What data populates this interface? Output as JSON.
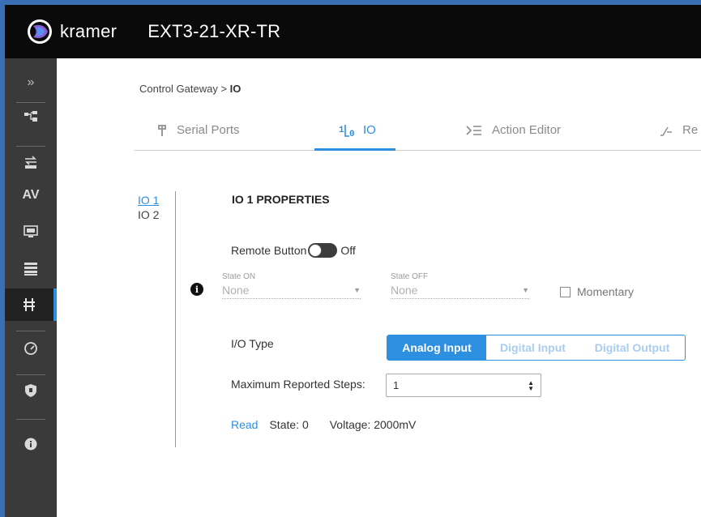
{
  "app": {
    "brand": "kramer",
    "device_name": "EXT3-21-XR-TR"
  },
  "sidebar": {
    "items": [
      {
        "name": "expand",
        "icon": "double-chevron-right-icon"
      },
      {
        "name": "routing",
        "icon": "routing-icon"
      },
      {
        "name": "auto-switching",
        "icon": "auto-switch-icon"
      },
      {
        "name": "av",
        "label": "AV"
      },
      {
        "name": "edid",
        "icon": "edid-icon"
      },
      {
        "name": "settings",
        "icon": "device-settings-icon"
      },
      {
        "name": "control-gateway",
        "icon": "control-gateway-icon",
        "active": true
      },
      {
        "name": "diagnostics",
        "icon": "gauge-icon"
      },
      {
        "name": "security",
        "icon": "shield-icon"
      },
      {
        "name": "about",
        "icon": "info-icon"
      }
    ],
    "accent": "#2d8fe0"
  },
  "breadcrumb": {
    "parent": "Control Gateway",
    "separator": ">",
    "current": "IO"
  },
  "tabs": [
    {
      "label": "Serial Ports",
      "icon": "serial-port-icon"
    },
    {
      "label": "IO",
      "icon": "io-icon",
      "active": true
    },
    {
      "label": "Action Editor",
      "icon": "action-editor-icon"
    },
    {
      "label": "Re",
      "icon": "relay-icon"
    }
  ],
  "io_list": [
    {
      "label": "IO 1",
      "active": true
    },
    {
      "label": "IO 2"
    }
  ],
  "properties": {
    "title": "IO 1 PROPERTIES",
    "remote_button": {
      "label": "Remote Button",
      "state": "Off"
    },
    "state_on": {
      "label": "State ON",
      "value": "None"
    },
    "state_off": {
      "label": "State OFF",
      "value": "None"
    },
    "momentary": {
      "label": "Momentary",
      "checked": false
    },
    "io_type": {
      "label": "I/O Type",
      "options": [
        "Analog Input",
        "Digital Input",
        "Digital Output"
      ],
      "selected": "Analog Input"
    },
    "max_steps": {
      "label": "Maximum Reported Steps:",
      "value": "1"
    },
    "read": {
      "link": "Read",
      "state": "State: 0",
      "voltage": "Voltage: 2000mV"
    }
  }
}
